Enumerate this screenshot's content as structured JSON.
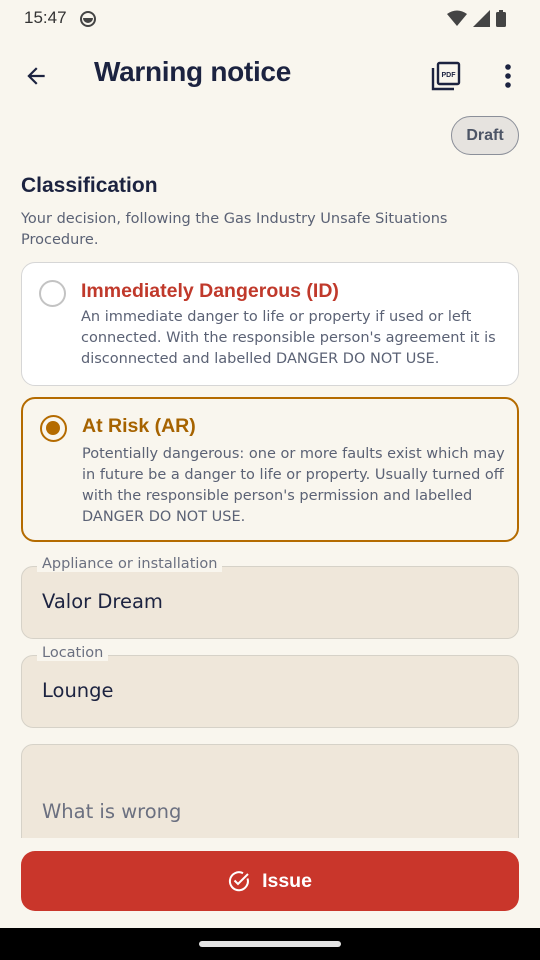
{
  "status_bar": {
    "time": "15:47",
    "icons": [
      "app-notification-icon",
      "wifi-icon",
      "signal-icon",
      "battery-icon"
    ]
  },
  "app_bar": {
    "title": "Warning notice",
    "back_icon": "arrow-back-icon",
    "pdf_icon": "pdf-icon",
    "more_icon": "more-vert-icon"
  },
  "status_chip": "Draft",
  "classification": {
    "title": "Classification",
    "description": "Your decision, following the Gas Industry Unsafe Situations Procedure.",
    "options": [
      {
        "title": "Immediately Dangerous (ID)",
        "text": "An immediate danger to life or property if used or left connected. With the responsible person's agreement it is disconnected and labelled DANGER DO NOT USE.",
        "selected": false,
        "color": "#c0392b"
      },
      {
        "title": "At Risk (AR)",
        "text": "Potentially dangerous: one or more faults exist which may in future be a danger to life or property. Usually turned off with the responsible person's permission and labelled DANGER DO NOT USE.",
        "selected": true,
        "color": "#a66300"
      }
    ]
  },
  "fields": {
    "appliance": {
      "label": "Appliance or installation",
      "value": "Valor Dream"
    },
    "location": {
      "label": "Location",
      "value": "Lounge"
    },
    "what_is_wrong": {
      "placeholder": "What is wrong",
      "value": ""
    }
  },
  "actions": {
    "issue_label": "Issue",
    "issue_icon": "check-circle-icon",
    "issue_color": "#c9362b"
  },
  "colors": {
    "background": "#f9f6ee",
    "accent": "#b46b00",
    "danger": "#c0392b"
  }
}
